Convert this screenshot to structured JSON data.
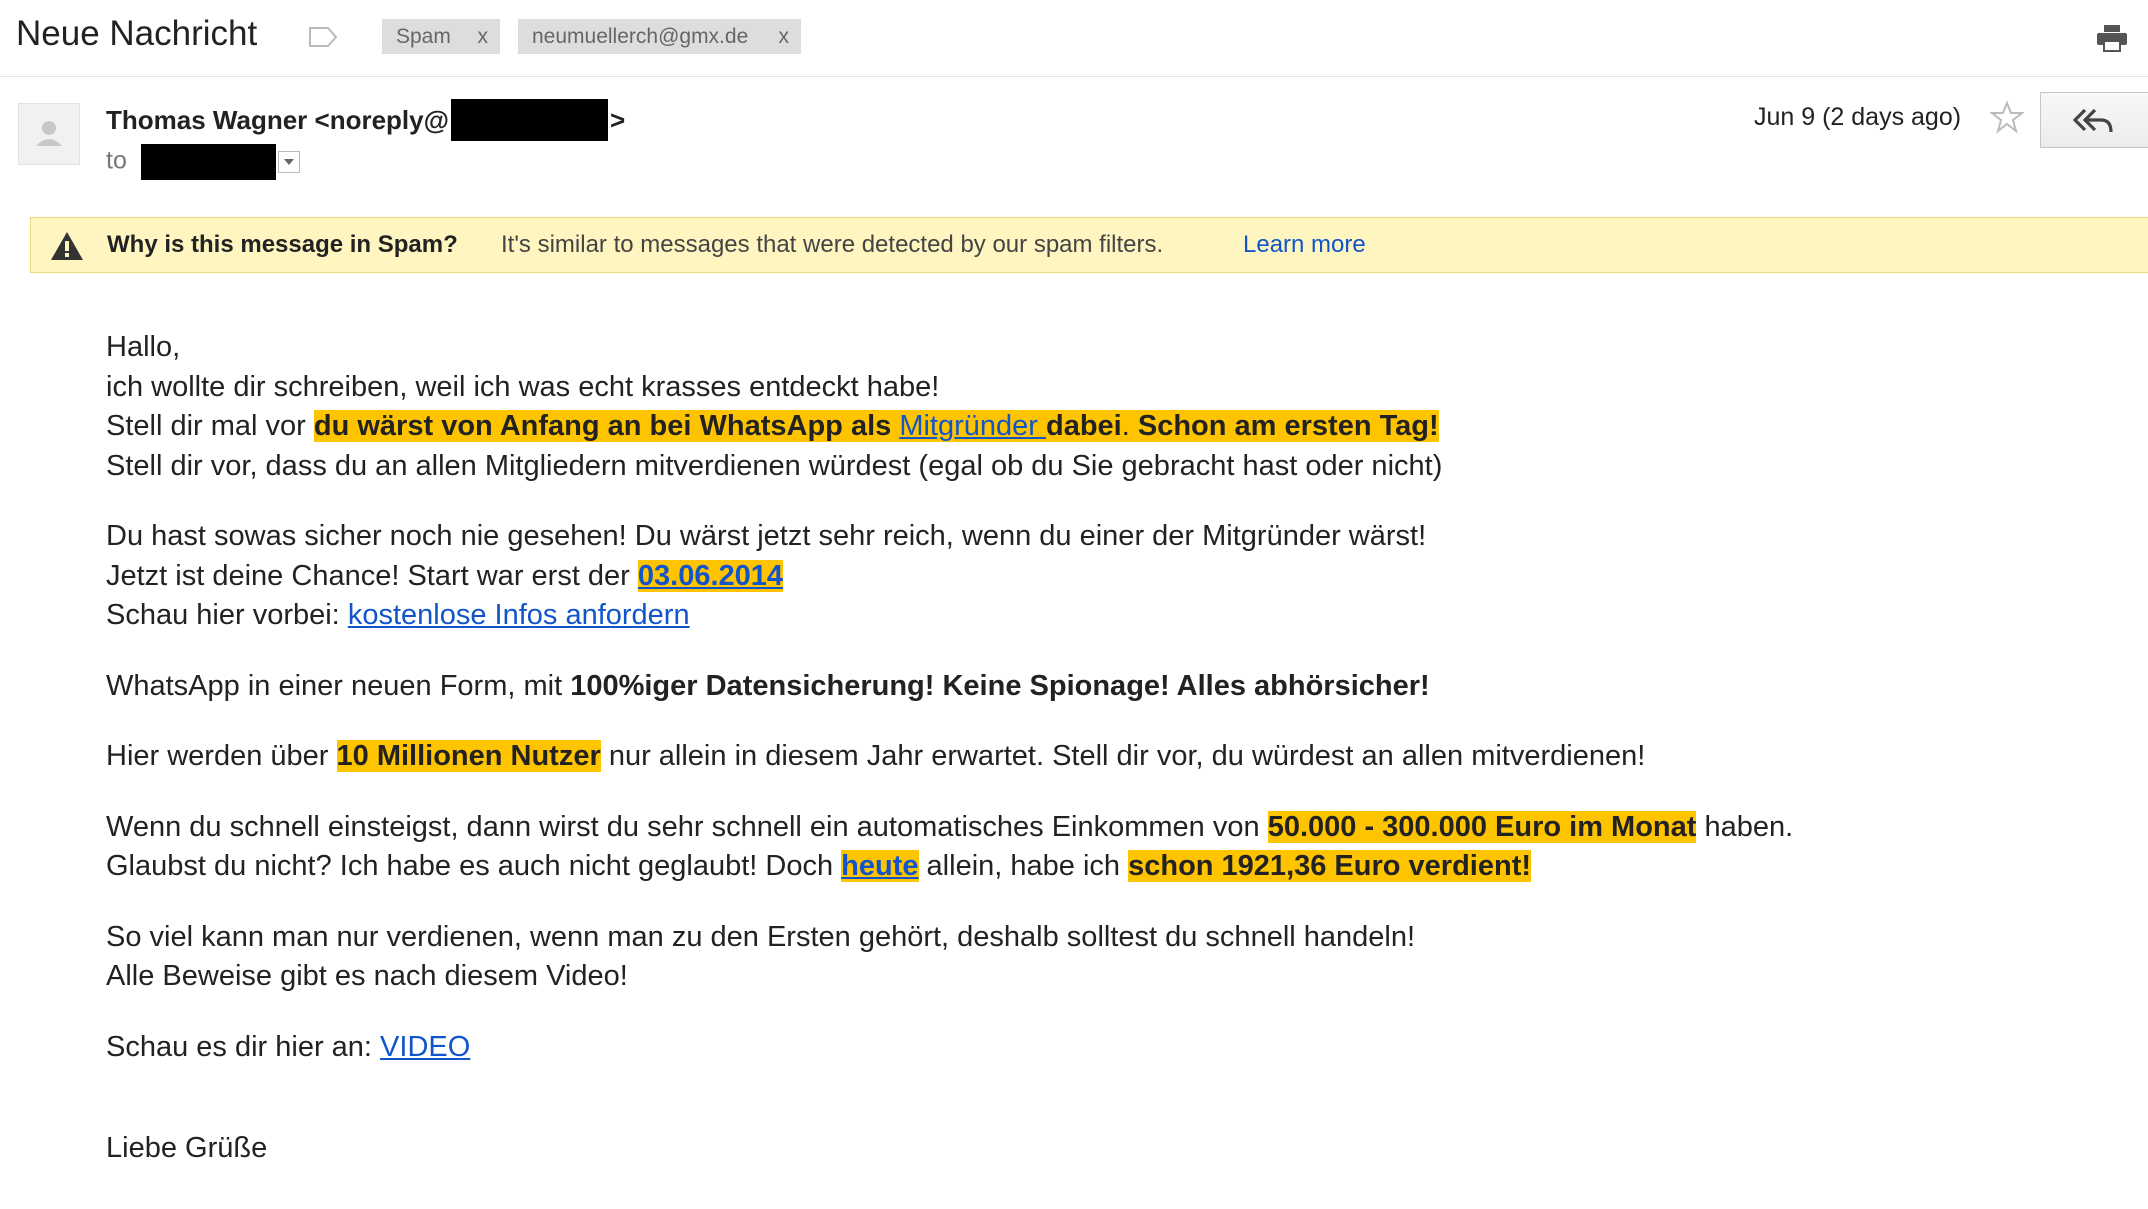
{
  "toolbar": {
    "subject": "Neue Nachricht",
    "labels": [
      {
        "name": "Spam",
        "remove": "x"
      },
      {
        "name": "neumuellerch@gmx.de",
        "remove": "x"
      }
    ]
  },
  "header": {
    "sender_prefix": "Thomas Wagner <noreply@",
    "sender_suffix": ">",
    "to_label": "to",
    "date": "Jun 9 (2 days ago)"
  },
  "spam_banner": {
    "question": "Why is this message in Spam?",
    "explanation": "It's similar to messages that were detected by our spam filters.",
    "link": "Learn more"
  },
  "email": {
    "p1": {
      "l1": "Hallo,",
      "l2": "ich wollte dir schreiben, weil ich was echt krasses entdeckt habe!",
      "l3_pre": "Stell dir mal vor ",
      "l3_hl1": "du wärst von Anfang an bei WhatsApp als ",
      "l3_link": "Mitgründer ",
      "l3_hl2": "dabei",
      "l3_mid": ". ",
      "l3_hl3": "Schon am ersten Tag!",
      "l4": "Stell dir vor, dass du an allen Mitgliedern mitverdienen würdest (egal ob du Sie gebracht hast oder nicht)"
    },
    "p2": {
      "l1": "Du hast sowas sicher noch nie gesehen! Du wärst jetzt sehr reich, wenn du einer der Mitgründer wärst!",
      "l2_pre": "Jetzt ist deine Chance! Start war erst der ",
      "l2_date": "03.06.2014",
      "l3_pre": "Schau hier vorbei: ",
      "l3_link": "kostenlose Infos anfordern"
    },
    "p3": {
      "pre": "WhatsApp in einer neuen Form, mit ",
      "bold": "100%iger Datensicherung! Keine Spionage! Alles abhörsicher!"
    },
    "p4": {
      "pre": "Hier werden über ",
      "hl": "10 Millionen Nutzer",
      "post": " nur allein in diesem Jahr erwartet. Stell dir vor, du würdest an allen mitverdienen!"
    },
    "p5": {
      "l1_pre": "Wenn du schnell einsteigst, dann wirst du sehr schnell ein automatisches Einkommen von ",
      "l1_hl": "50.000 - 300.000 Euro im Monat",
      "l1_post": " haben.",
      "l2_pre": "Glaubst du nicht? Ich habe es auch nicht geglaubt! Doch ",
      "l2_link": "heute",
      "l2_mid": " allein, habe ich ",
      "l2_hl": "schon 1921,36 Euro verdient!"
    },
    "p6": {
      "l1": "So viel kann man nur verdienen, wenn man zu den Ersten gehört, deshalb solltest du schnell handeln!",
      "l2": "Alle Beweise gibt es nach diesem Video!"
    },
    "p7": {
      "pre": "Schau es dir hier an: ",
      "link": "VIDEO"
    },
    "closing": "Liebe Grüße"
  },
  "colors": {
    "highlight": "#ffc400",
    "link": "#1155cc",
    "spam_banner_bg": "#fff5c0"
  },
  "icons": [
    "label-icon",
    "print-icon",
    "avatar-icon",
    "star-icon",
    "reply-icon",
    "warning-icon",
    "dropdown-icon"
  ]
}
